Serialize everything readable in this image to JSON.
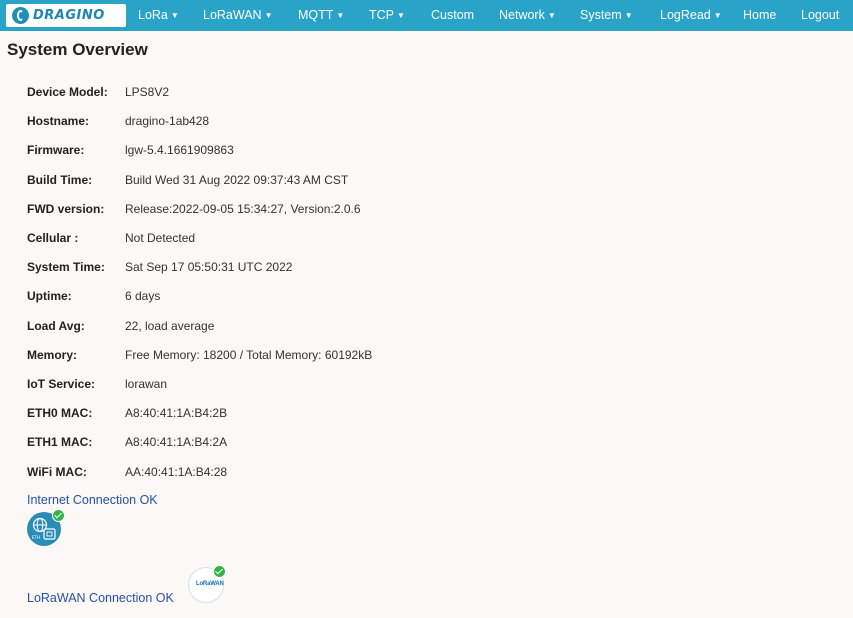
{
  "brand": {
    "logo_text": "DRAGINO"
  },
  "nav": [
    {
      "id": "lora",
      "label": "LoRa",
      "dropdown": true
    },
    {
      "id": "lorawan",
      "label": "LoRaWAN",
      "dropdown": true
    },
    {
      "id": "mqtt",
      "label": "MQTT",
      "dropdown": true
    },
    {
      "id": "tcp",
      "label": "TCP",
      "dropdown": true
    },
    {
      "id": "custom",
      "label": "Custom",
      "dropdown": false
    },
    {
      "id": "network",
      "label": "Network",
      "dropdown": true
    },
    {
      "id": "system",
      "label": "System",
      "dropdown": true
    },
    {
      "id": "logread",
      "label": "LogRead",
      "dropdown": true
    },
    {
      "id": "home",
      "label": "Home",
      "dropdown": false
    },
    {
      "id": "logout",
      "label": "Logout",
      "dropdown": false
    }
  ],
  "page": {
    "title": "System Overview"
  },
  "info": [
    {
      "label": "Device Model:",
      "value": "LPS8V2"
    },
    {
      "label": "Hostname:",
      "value": "dragino-1ab428"
    },
    {
      "label": "Firmware:",
      "value": "lgw-5.4.1661909863"
    },
    {
      "label": "Build Time:",
      "value": "Build Wed 31 Aug 2022 09:37:43 AM CST"
    },
    {
      "label": "FWD version:",
      "value": "Release:2022-09-05 15:34:27, Version:2.0.6"
    },
    {
      "label": "Cellular :",
      "value": "Not Detected"
    },
    {
      "label": "System Time:",
      "value": "Sat Sep 17 05:50:31 UTC 2022"
    },
    {
      "label": "Uptime:",
      "value": "6 days"
    },
    {
      "label": "Load Avg:",
      "value": "22, load average"
    },
    {
      "label": "Memory:",
      "value": "Free Memory: 18200 / Total Memory: 60192kB"
    },
    {
      "label": "IoT Service:",
      "value": "lorawan"
    },
    {
      "label": "ETH0 MAC:",
      "value": "A8:40:41:1A:B4:2B"
    },
    {
      "label": "ETH1 MAC:",
      "value": "A8:40:41:1A:B4:2A"
    },
    {
      "label": "WiFi MAC:",
      "value": "AA:40:41:1A:B4:28"
    }
  ],
  "status": {
    "internet": "Internet Connection OK",
    "lorawan": "LoRaWAN Connection OK",
    "lorawan_logo_text": "LoRaWAN"
  },
  "colors": {
    "navbar": "#2aa3c8",
    "link_text": "#2451a8",
    "ok_badge": "#36b24a",
    "background": "#fbf8f6"
  },
  "icons": {
    "internet": "globe-ethernet-icon",
    "lorawan": "lorawan-logo-icon",
    "ok": "check-badge-icon"
  }
}
